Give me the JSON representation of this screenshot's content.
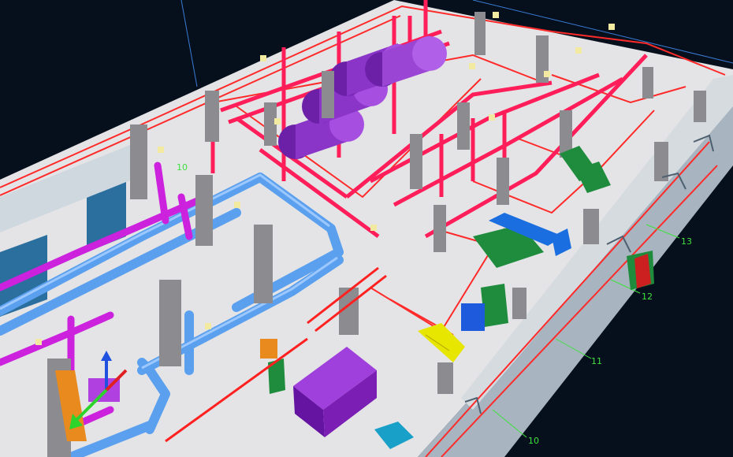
{
  "viewport": {
    "background": "#06101c",
    "floor_color": "#e4e4e6",
    "wall_outline_color": "#ff2a2a",
    "axis_line_color": "#3fe03f",
    "axis_label_color": "#3fe03f"
  },
  "axis_labels": {
    "label_13": "13",
    "label_12": "12",
    "label_11": "11",
    "label_10": "10",
    "label_10_left": "10"
  },
  "equipment": {
    "boiler_color": "#8a35c8",
    "red_pipe_color": "#ff1e5a",
    "blue_pipe_color": "#5aa0ee",
    "magenta_pipe_color": "#cc22dd",
    "column_color": "#8c8c90",
    "green_tank_color": "#1e8c3c",
    "purple_tank_color": "#7a1eb4",
    "yellow_stair_color": "#e6e600"
  },
  "gizmo": {
    "x_color": "#2cd42c",
    "y_color": "#e02020",
    "z_color": "#2050e0"
  }
}
